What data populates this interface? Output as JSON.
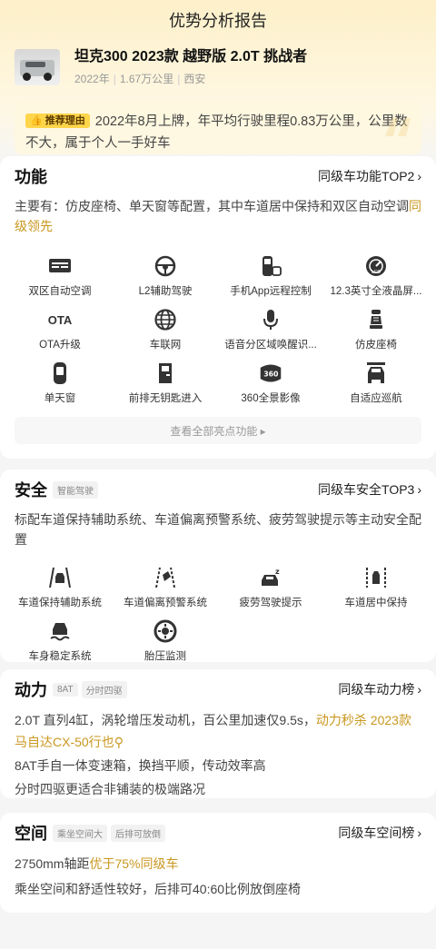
{
  "header": {
    "title": "优势分析报告"
  },
  "car": {
    "name": "坦克300 2023款 越野版 2.0T 挑战者",
    "year": "2022年",
    "mileage": "1.67万公里",
    "city": "西安"
  },
  "reason": {
    "badge": "推荐理由",
    "text": "2022年8月上牌，年平均行驶里程0.83万公里，公里数不大，属于个人一手好车"
  },
  "function": {
    "title": "功能",
    "rank_link": "同级车功能TOP2",
    "desc_main": "主要有：仿皮座椅、单天窗等配置，其中车道居中保持和双区自动空调",
    "desc_highlight": "同级领先",
    "items": [
      {
        "label": "双区自动空调",
        "icon": "climate-icon"
      },
      {
        "label": "L2辅助驾驶",
        "icon": "steering-wheel-icon"
      },
      {
        "label": "手机App远程控制",
        "icon": "phone-remote-icon"
      },
      {
        "label": "12.3英寸全液晶屏...",
        "icon": "lcd-gauge-icon"
      },
      {
        "label": "OTA升级",
        "icon": "ota-icon",
        "icon_text": "OTA"
      },
      {
        "label": "车联网",
        "icon": "globe-icon"
      },
      {
        "label": "语音分区域唤醒识...",
        "icon": "microphone-icon"
      },
      {
        "label": "仿皮座椅",
        "icon": "seat-icon"
      },
      {
        "label": "单天窗",
        "icon": "sunroof-icon"
      },
      {
        "label": "前排无钥匙进入",
        "icon": "car-door-icon"
      },
      {
        "label": "360全景影像",
        "icon": "camera-360-icon",
        "icon_text": "360"
      },
      {
        "label": "自适应巡航",
        "icon": "cruise-icon"
      }
    ],
    "more": "查看全部亮点功能 ▸"
  },
  "safety": {
    "title": "安全",
    "tag": "智能驾驶",
    "rank_link": "同级车安全TOP3",
    "desc": "标配车道保持辅助系统、车道偏离预警系统、疲劳驾驶提示等主动安全配置",
    "items": [
      {
        "label": "车道保持辅助系统",
        "icon": "lane-keep-icon"
      },
      {
        "label": "车道偏离预警系统",
        "icon": "lane-departure-icon"
      },
      {
        "label": "疲劳驾驶提示",
        "icon": "fatigue-icon"
      },
      {
        "label": "车道居中保持",
        "icon": "lane-center-icon"
      },
      {
        "label": "车身稳定系统",
        "icon": "stability-icon"
      },
      {
        "label": "胎压监测",
        "icon": "tire-pressure-icon"
      }
    ]
  },
  "power": {
    "title": "动力",
    "tags": [
      "8AT",
      "分时四驱"
    ],
    "rank_link": "同级车动力榜",
    "line1_main": "2.0T 直列4缸，涡轮增压发动机，百公里加速仅9.5s，",
    "line1_highlight": "动力秒杀 2023款马自达CX-50行也",
    "line2": "8AT手自一体变速箱，换挡平顺，传动效率高",
    "line3": "分时四驱更适合非铺装的极端路况"
  },
  "space": {
    "title": "空间",
    "tags": [
      "乘坐空间大",
      "后排可放倒"
    ],
    "rank_link": "同级车空间榜",
    "line1_main": "2750mm轴距",
    "line1_highlight": "优于75%同级车",
    "line2": "乘坐空间和舒适性较好，后排可40:60比例放倒座椅"
  },
  "colors": {
    "accent": "#c9971f",
    "badge": "#ffd54a",
    "icon": "#333333"
  }
}
